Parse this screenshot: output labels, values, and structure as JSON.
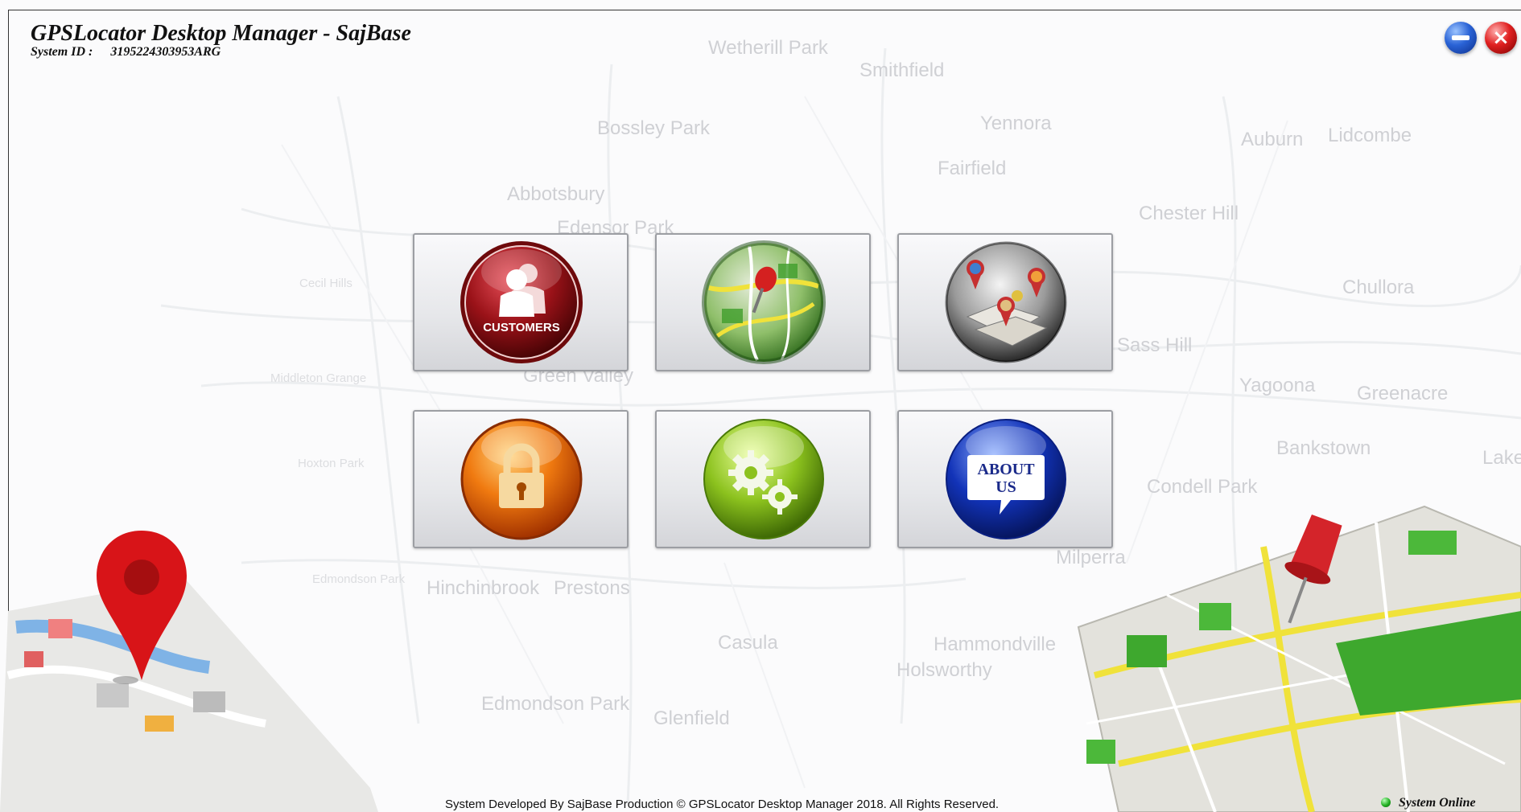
{
  "window": {
    "title": "GPSLocator Desktop Manager - SajBase",
    "system_id_label": "System ID :",
    "system_id_value": "3195224303953ARG"
  },
  "background_places": [
    {
      "name": "Wetherill Park",
      "size": "big"
    },
    {
      "name": "Smithfield",
      "size": "big"
    },
    {
      "name": "Bossley Park",
      "size": "big"
    },
    {
      "name": "Yennora",
      "size": "big"
    },
    {
      "name": "Auburn",
      "size": "big"
    },
    {
      "name": "Lidcombe",
      "size": "big"
    },
    {
      "name": "Fairfield",
      "size": "big"
    },
    {
      "name": "Abbotsbury",
      "size": "big"
    },
    {
      "name": "Edensor Park",
      "size": "big"
    },
    {
      "name": "Chester Hill",
      "size": "big"
    },
    {
      "name": "Chullora",
      "size": "big"
    },
    {
      "name": "Cecil Hills",
      "size": "small"
    },
    {
      "name": "Green Valley",
      "size": "big"
    },
    {
      "name": "Sass Hill",
      "size": "big"
    },
    {
      "name": "Yagoona",
      "size": "big"
    },
    {
      "name": "Greenacre",
      "size": "big"
    },
    {
      "name": "Middleton Grange",
      "size": "small"
    },
    {
      "name": "Hoxton Park",
      "size": "small"
    },
    {
      "name": "Bankstown",
      "size": "big"
    },
    {
      "name": "Condell Park",
      "size": "big"
    },
    {
      "name": "Hinchinbrook",
      "size": "big"
    },
    {
      "name": "Prestons",
      "size": "big"
    },
    {
      "name": "Milperra",
      "size": "big"
    },
    {
      "name": "Edmondson Park",
      "size": "small"
    },
    {
      "name": "Casula",
      "size": "big"
    },
    {
      "name": "Hammondville",
      "size": "big"
    },
    {
      "name": "Holsworthy",
      "size": "big"
    },
    {
      "name": "Glenfield",
      "size": "big"
    },
    {
      "name": "Edmondson Park",
      "size": "big"
    },
    {
      "name": "Lakemba",
      "size": "big"
    }
  ],
  "tiles": [
    {
      "id": "customers",
      "orb_text": "CUSTOMERS"
    },
    {
      "id": "map"
    },
    {
      "id": "people"
    },
    {
      "id": "security"
    },
    {
      "id": "settings"
    },
    {
      "id": "about",
      "orb_text_line1": "ABOUT",
      "orb_text_line2": "US"
    }
  ],
  "footer": {
    "copyright": "System Developed By SajBase Production © GPSLocator Desktop Manager 2018. All Rights Reserved.",
    "status": "System Online"
  },
  "colors": {
    "status_online": "#22b022",
    "customers_orb": "#8e0f12",
    "security_orb": "#f07a10",
    "settings_orb": "#8cc21e",
    "about_orb": "#1233b8"
  }
}
